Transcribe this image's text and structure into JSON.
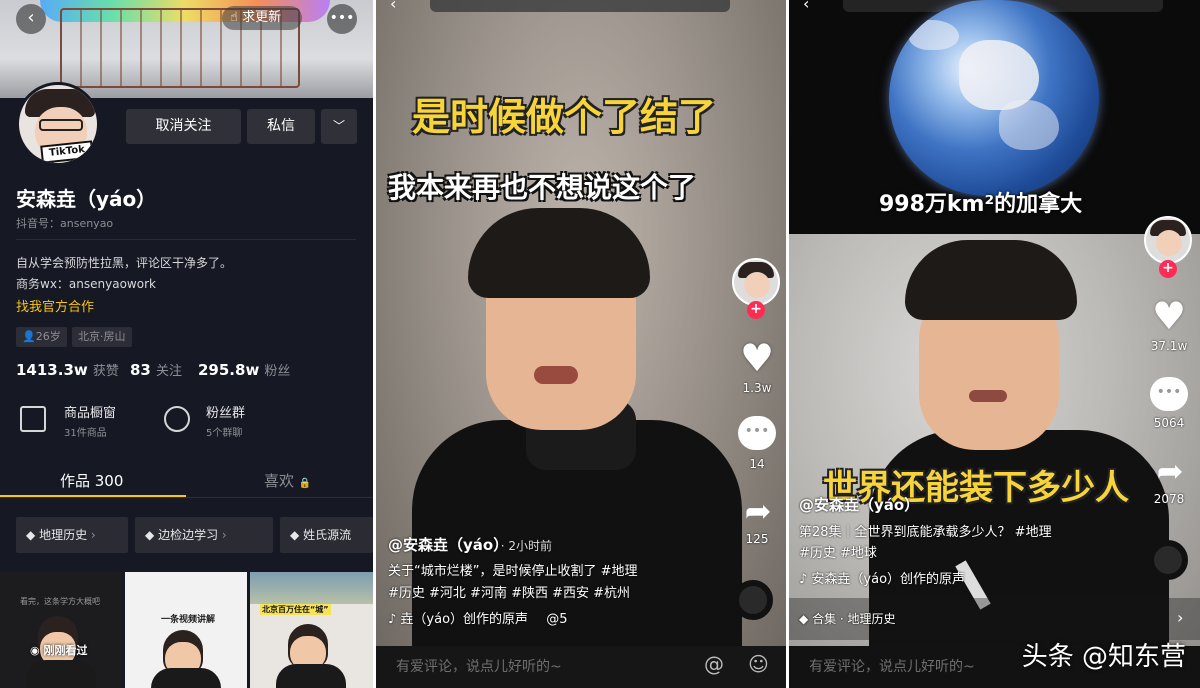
{
  "profile_panel": {
    "update_pill": "求更新",
    "more_icon": "more-horizontal-icon",
    "back_icon": "chevron-left-icon",
    "avatar_text": "TikTok",
    "unfollow_button": "取消关注",
    "message_button": "私信",
    "name": "安森垚（yáo）",
    "douyin_id_label": "抖音号：",
    "douyin_id": "ansenyao",
    "bio_line1": "自从学会预防性拉黑，评论区干净多了。",
    "bio_line2": "商务wx：ansenyaowork",
    "official_link": "找我官方合作",
    "tags": [
      "26岁",
      "北京·房山"
    ],
    "stats": [
      {
        "num": "1413.3w",
        "label": "获赞"
      },
      {
        "num": "83",
        "label": "关注"
      },
      {
        "num": "295.8w",
        "label": "粉丝"
      }
    ],
    "features": [
      {
        "title": "商品橱窗",
        "sub": "31件商品",
        "icon": "cart-icon"
      },
      {
        "title": "粉丝群",
        "sub": "5个群聊",
        "icon": "group-icon"
      }
    ],
    "tab_works": "作品 300",
    "tab_likes": "喜欢",
    "collections": [
      "地理历史",
      "边检边学习",
      "姓氏源流"
    ],
    "thumb1_badge": "刚刚看过",
    "thumb1_text": "看完，这条学方大概吧",
    "thumb2_text": "一条视频讲解",
    "thumb3_text": "北京百万住在“城”"
  },
  "video_panel_1": {
    "caption_top": "是时候做个了结了",
    "caption_second": "我本来再也不想说这个了",
    "like_count": "1.3w",
    "comment_count": "14",
    "share_count": "125",
    "author": "@安森垚（yáo）",
    "time": "· 2小时前",
    "desc_line1": "关于“城市烂楼”，是时候停止收割了 #地理",
    "desc_line2": "#历史 #河北 #河南 #陕西 #西安 #杭州",
    "music": "♪ 垚（yáo）创作的原声",
    "music_tail": "@5",
    "comment_placeholder": "有爱评论，说点儿好听的~",
    "at_icon": "at-icon",
    "emoji_icon": "emoji-icon"
  },
  "video_panel_2": {
    "earth_caption": "998万km²的加拿大",
    "overlay_caption": "世界还能装下多少人",
    "like_count": "37.1w",
    "comment_count": "5064",
    "share_count": "2078",
    "author": "@安森垚（yáo）",
    "desc_line1": "第28集｜全世界到底能承载多少人？ #地理",
    "desc_line2": "#历史 #地球",
    "music": "♪ 安森垚（yáo）创作的原声",
    "collection": "合集 · 地理历史",
    "comment_placeholder": "有爱评论，说点儿好听的~",
    "watermark": "头条 @知东营"
  },
  "colors": {
    "accent_yellow": "#f5c518",
    "like_red": "#fe2c55",
    "profile_bg": "#161823"
  }
}
